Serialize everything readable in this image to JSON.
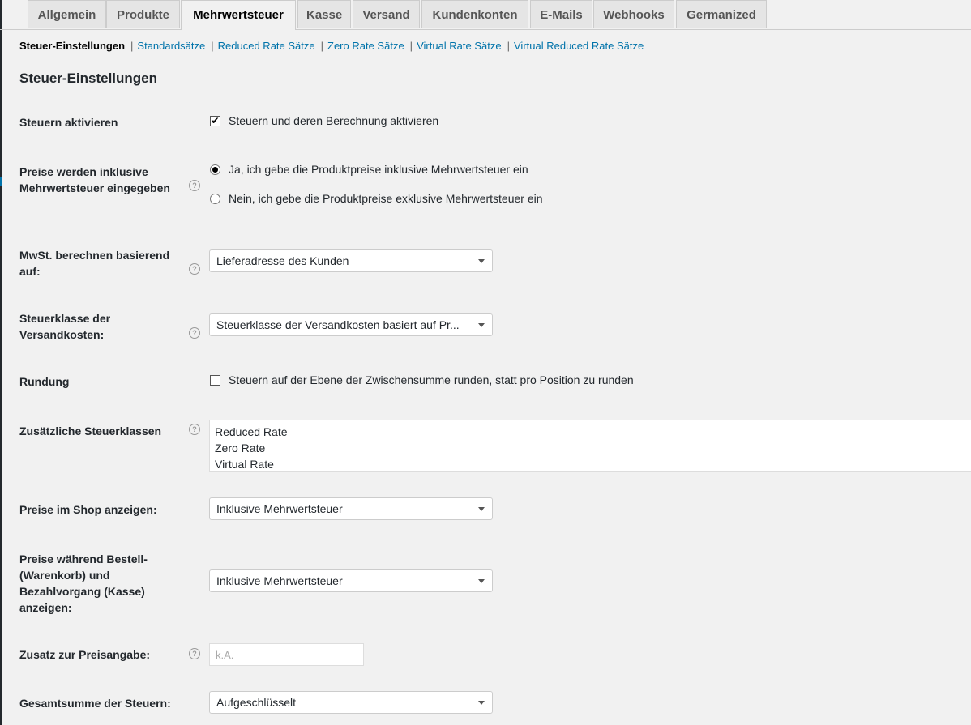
{
  "tabs": [
    {
      "label": "Allgemein"
    },
    {
      "label": "Produkte"
    },
    {
      "label": "Mehrwertsteuer"
    },
    {
      "label": "Kasse"
    },
    {
      "label": "Versand"
    },
    {
      "label": "Kundenkonten"
    },
    {
      "label": "E-Mails"
    },
    {
      "label": "Webhooks"
    },
    {
      "label": "Germanized"
    }
  ],
  "subnav": {
    "current": "Steuer-Einstellungen",
    "links": [
      "Standardsätze",
      "Reduced Rate Sätze",
      "Zero Rate Sätze",
      "Virtual Rate Sätze",
      "Virtual Reduced Rate Sätze"
    ],
    "separator": "|"
  },
  "section_title": "Steuer-Einstellungen",
  "help_glyph": "?",
  "fields": {
    "enable_taxes": {
      "label": "Steuern aktivieren",
      "checkbox_label": "Steuern und deren Berechnung aktivieren",
      "checked": true,
      "check_glyph": "✔"
    },
    "prices_include_tax": {
      "label_line1": "Preise werden inklusive",
      "label_line2": "Mehrwertsteuer eingegeben",
      "options": [
        "Ja, ich gebe die Produktpreise inklusive Mehrwertsteuer ein",
        "Nein, ich gebe die Produktpreise exklusive Mehrwertsteuer ein"
      ],
      "selected_index": 0
    },
    "tax_based_on": {
      "label_line1": "MwSt. berechnen basierend",
      "label_line2": "auf:",
      "value": "Lieferadresse des Kunden"
    },
    "shipping_tax_class": {
      "label_line1": "Steuerklasse der",
      "label_line2": "Versandkosten:",
      "value": "Steuerklasse der Versandkosten basiert auf Pr..."
    },
    "rounding": {
      "label": "Rundung",
      "checkbox_label": "Steuern auf der Ebene der Zwischensumme runden, statt pro Position zu runden",
      "checked": false
    },
    "additional_tax_classes": {
      "label": "Zusätzliche Steuerklassen",
      "items": [
        "Reduced Rate",
        "Zero Rate",
        "Virtual Rate"
      ]
    },
    "display_shop": {
      "label": "Preise im Shop anzeigen:",
      "value": "Inklusive Mehrwertsteuer"
    },
    "display_cart": {
      "label_line1": "Preise während Bestell-",
      "label_line2": "(Warenkorb) und",
      "label_line3": "Bezahlvorgang (Kasse)",
      "label_line4": "anzeigen:",
      "value": "Inklusive Mehrwertsteuer"
    },
    "price_suffix": {
      "label": "Zusatz zur Preisangabe:",
      "placeholder": "k.A.",
      "value": ""
    },
    "tax_total_display": {
      "label": "Gesamtsumme der Steuern:",
      "value": "Aufgeschlüsselt"
    }
  }
}
